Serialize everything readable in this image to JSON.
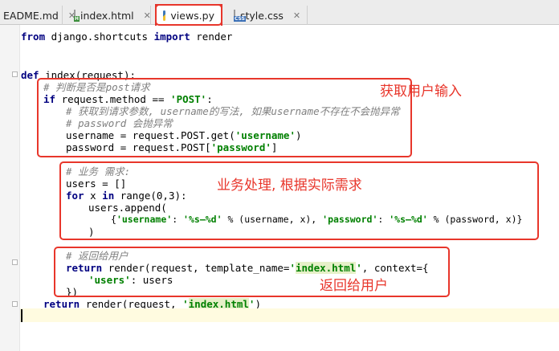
{
  "tabs": [
    {
      "label": "EADME.md",
      "icon": "markdown-file-icon",
      "active": false
    },
    {
      "label": "index.html",
      "icon": "html-file-icon",
      "active": false
    },
    {
      "label": "views.py",
      "icon": "python-file-icon",
      "active": true
    },
    {
      "label": "style.css",
      "icon": "css-file-icon",
      "active": false
    }
  ],
  "icons": {
    "html_badge": "H",
    "css_badge": "CSS",
    "close": "✕"
  },
  "code": {
    "line1": {
      "a": "from ",
      "b": "django.shortcuts ",
      "c": "import ",
      "d": "render"
    },
    "line4": {
      "a": "def ",
      "b": "index(request):"
    },
    "line5": {
      "a": "# 判断是否是",
      "b": "post",
      "c": "请求"
    },
    "line6": {
      "a": "if ",
      "b": "request.method == ",
      "c": "'POST'",
      "d": ":"
    },
    "line7": {
      "a": "# 获取到请求参数, ",
      "b": "username",
      "c": "的写法, 如果",
      "d": "username",
      "e": "不存在不会抛异常"
    },
    "line8": {
      "a": "# ",
      "b": "password ",
      "c": "会抛异常"
    },
    "line9": {
      "a": "username = request.POST.get(",
      "b": "'username'",
      "c": ")"
    },
    "line10": {
      "a": "password = request.POST[",
      "b": "'password'",
      "c": "]"
    },
    "line12": {
      "a": "# 业务 需求:"
    },
    "line13": {
      "a": "users = []"
    },
    "line14": {
      "a": "for ",
      "b": "x ",
      "c": "in ",
      "d": "range(0,3):"
    },
    "line15": {
      "a": "users.append("
    },
    "line16": {
      "a": "{",
      "b": "'username'",
      "c": ": ",
      "d": "'%s—%d'",
      "e": " % (username, x), ",
      "f": "'password'",
      "g": ": ",
      "h": "'%s—%d'",
      "i": " % (password, x)}"
    },
    "line17": {
      "a": ")"
    },
    "line19": {
      "a": "# 返回给用户"
    },
    "line20": {
      "a": "return ",
      "b": "render(request, template_name=",
      "c": "'",
      "d": "index.html",
      "e": "'",
      "f": ", context={"
    },
    "line21": {
      "a": "'users'",
      "b": ": users"
    },
    "line22": {
      "a": "})"
    },
    "line23": {
      "a": "return ",
      "b": "render(request, ",
      "c": "'",
      "d": "index.html",
      "e": "'",
      "f": ")"
    }
  },
  "annotations": {
    "get_input": "获取用户输入",
    "business": "业务处理, 根据实际需求",
    "return_user": "返回给用户"
  },
  "colors": {
    "annotation": "#e8362b",
    "keyword": "#000080",
    "string": "#008000",
    "comment": "#808080"
  }
}
